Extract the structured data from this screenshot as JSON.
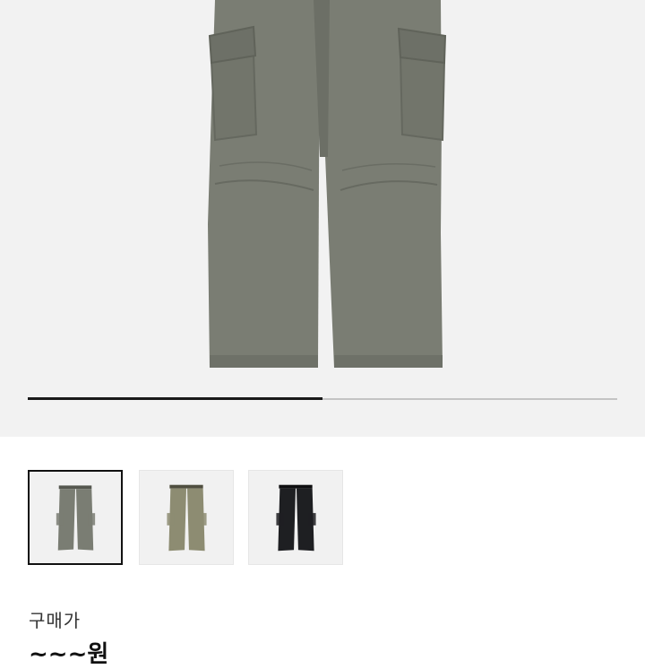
{
  "gallery": {
    "progress": 0.5,
    "thumbnails": [
      {
        "color_name": "gray",
        "color": "#7a7d73",
        "selected": true
      },
      {
        "color_name": "khaki",
        "color": "#8d8c72",
        "selected": false
      },
      {
        "color_name": "black",
        "color": "#1e1f22",
        "selected": false
      }
    ]
  },
  "product": {
    "price_label": "구매가",
    "price_value": "~~~원"
  }
}
